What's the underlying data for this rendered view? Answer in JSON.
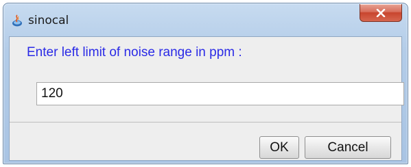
{
  "window": {
    "title": "sinocal",
    "icon": "java-app-icon",
    "close_icon": "close-x-icon"
  },
  "dialog": {
    "prompt": "Enter left limit of noise range in ppm :",
    "input_value": "120",
    "ok_label": "OK",
    "cancel_label": "Cancel"
  },
  "colors": {
    "prompt_text": "#2a2ae6",
    "titlebar": "#b3cce8",
    "close_button": "#c8452e"
  }
}
